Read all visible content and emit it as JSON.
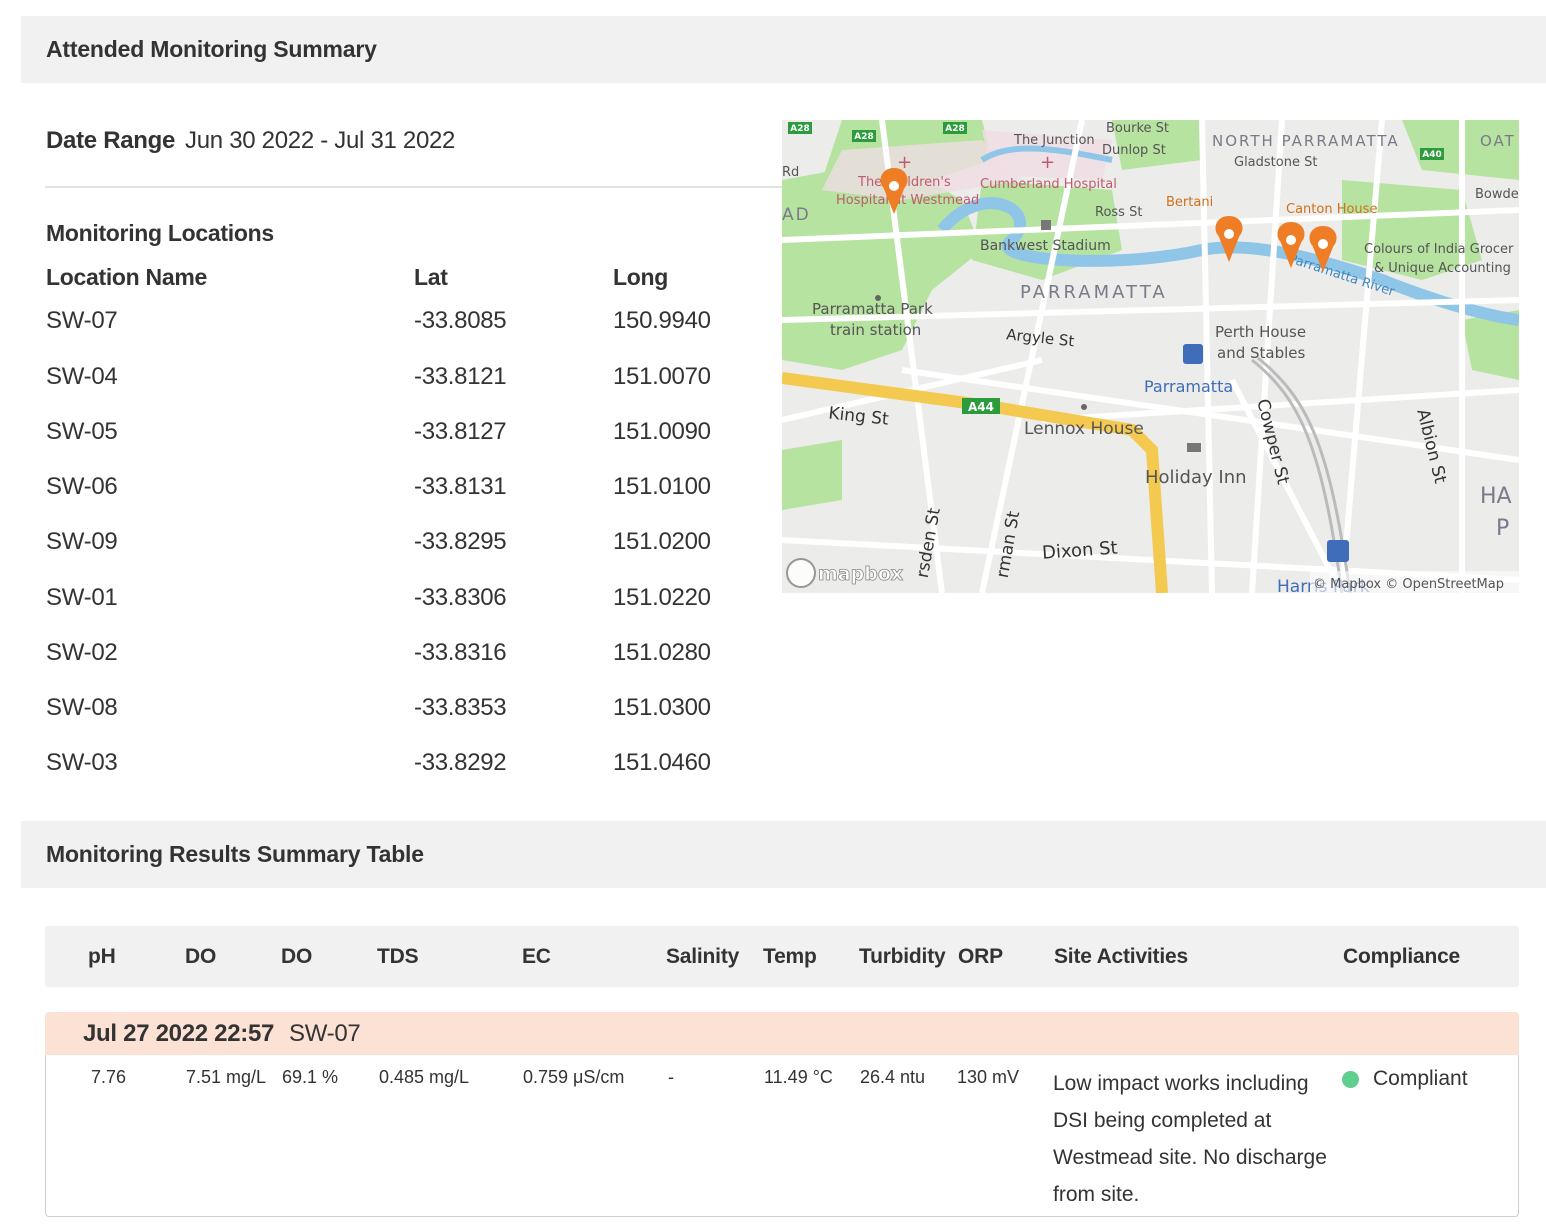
{
  "summary": {
    "title": "Attended Monitoring Summary",
    "date_range_label": "Date Range",
    "date_range_value": "Jun 30 2022 - Jul 31 2022"
  },
  "locations": {
    "title": "Monitoring Locations",
    "headers": {
      "name": "Location Name",
      "lat": "Lat",
      "long": "Long"
    },
    "rows": [
      {
        "name": "SW-07",
        "lat": "-33.8085",
        "long": "150.9940"
      },
      {
        "name": "SW-04",
        "lat": "-33.8121",
        "long": "151.0070"
      },
      {
        "name": "SW-05",
        "lat": "-33.8127",
        "long": "151.0090"
      },
      {
        "name": "SW-06",
        "lat": "-33.8131",
        "long": "151.0100"
      },
      {
        "name": "SW-09",
        "lat": "-33.8295",
        "long": "151.0200"
      },
      {
        "name": "SW-01",
        "lat": "-33.8306",
        "long": "151.0220"
      },
      {
        "name": "SW-02",
        "lat": "-33.8316",
        "long": "151.0280"
      },
      {
        "name": "SW-08",
        "lat": "-33.8353",
        "long": "151.0300"
      },
      {
        "name": "SW-03",
        "lat": "-33.8292",
        "long": "151.0460"
      }
    ]
  },
  "map": {
    "labels": {
      "a28_1": "A28",
      "a28_2": "A28",
      "a28_3": "A28",
      "a40": "A40",
      "a44": "A44",
      "junction": "The Junction",
      "bourke": "Bourke St",
      "dunlop": "Dunlop St",
      "north_parramatta": "NORTH PARRAMATTA",
      "oat": "OAT",
      "gladstone": "Gladstone St",
      "bowden": "Bowde",
      "rd": "Rd",
      "ad": "AD",
      "childrens1": "The Children's",
      "childrens2": "Hospital at Westmead",
      "cumberland": "Cumberland Hospital",
      "bertani": "Bertani",
      "canton": "Canton House",
      "ross": "Ross St",
      "bankwest": "Bankwest Stadium",
      "parramatta": "PARRAMATTA",
      "colours1": "Colours of India Grocer",
      "colours2": "& Unique Accounting",
      "river": "Parramatta River",
      "park1": "Parramatta Park",
      "park2": "train station",
      "argyle": "Argyle St",
      "perth1": "Perth House",
      "perth2": "and Stables",
      "station": "Parramatta",
      "king": "King St",
      "lennox": "Lennox House",
      "cowper": "Cowper St",
      "albion": "Albion St",
      "holiday": "Holiday Inn",
      "ha": "HA",
      "pa": "P",
      "dixon": "Dixon St",
      "marsden": "rsden St",
      "harman": "rman St",
      "harris": "Harris Park",
      "attribution": "© Mapbox © OpenStreetMap",
      "logo": "mapbox"
    },
    "colors": {
      "water": "#8fc6e8",
      "park": "#b6e3a0",
      "land": "#ececea",
      "road": "#ffffff",
      "highway": "#f3c94f",
      "marker": "#ee7d26"
    }
  },
  "results": {
    "title": "Monitoring Results Summary Table",
    "headers": {
      "ph": "pH",
      "do1": "DO",
      "do2": "DO",
      "tds": "TDS",
      "ec": "EC",
      "salinity": "Salinity",
      "temp": "Temp",
      "turbidity": "Turbidity",
      "orp": "ORP",
      "activities": "Site Activities",
      "compliance": "Compliance"
    },
    "group": {
      "date": "Jul 27 2022 22:57",
      "site": "SW-07"
    },
    "row": {
      "ph": "7.76",
      "do1": "7.51 mg/L",
      "do2": "69.1 %",
      "tds": "0.485 mg/L",
      "ec": "0.759 μS/cm",
      "salinity": "-",
      "temp": "11.49 °C",
      "turbidity": "26.4 ntu",
      "orp": "130 mV",
      "activities": "Low impact works including DSI being completed at Westmead site. No discharge from site.",
      "compliance": "Compliant",
      "compliance_color": "#5fcf8d"
    }
  }
}
